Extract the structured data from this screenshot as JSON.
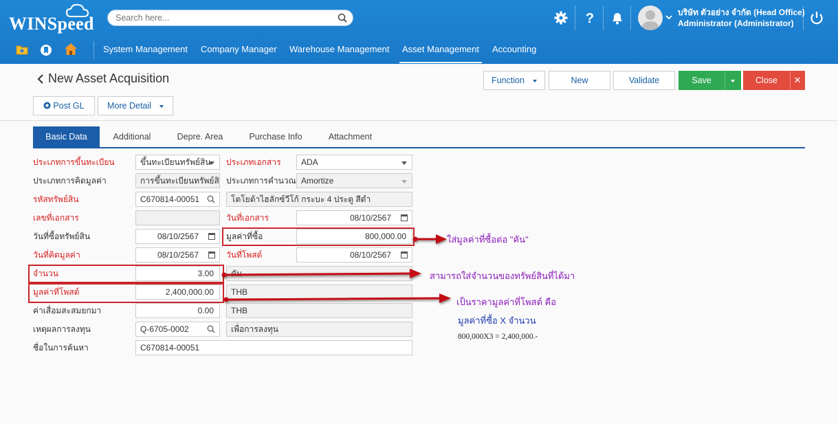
{
  "app": {
    "logo": "WINSpeed",
    "search_placeholder": "Search here...",
    "user_company": "บริษัท ตัวอย่าง จำกัด (Head Office)",
    "user_name": "Administrator (Administrator)"
  },
  "nav": [
    "System Management",
    "Company Manager",
    "Warehouse Management",
    "Asset Management",
    "Accounting"
  ],
  "page": {
    "title": "New Asset Acquisition",
    "buttons": {
      "function": "Function",
      "new": "New",
      "validate": "Validate",
      "save": "Save",
      "close": "Close",
      "post_gl": "Post GL",
      "more_detail": "More Detail"
    }
  },
  "tabs": [
    "Basic Data",
    "Additional",
    "Depre. Area",
    "Purchase Info",
    "Attachment"
  ],
  "form": {
    "reg_type_label": "ประเภทการขึ้นทะเบียน",
    "reg_type_value": "ขึ้นทะเบียนทรัพย์สิน",
    "doc_type_label": "ประเภทเอกสาร",
    "doc_type_value": "ADA",
    "calc_value_type_label": "ประเภทการคิดมูลค่า",
    "calc_value_type_value": "การขึ้นทะเบียนทรัพย์สิน",
    "calc_type_label": "ประเภทการคำนวณ",
    "calc_type_value": "Amortize",
    "asset_code_label": "รหัสทรัพย์สิน",
    "asset_code_value": "C670814-00051",
    "asset_name_value": "โตโยต้าไฮลักซ์วีโก้ กระบะ 4 ประตู สีดำ",
    "doc_no_label": "เลขที่เอกสาร",
    "doc_no_value": "",
    "doc_date_label": "วันที่เอกสาร",
    "doc_date_value": "08/10/2567",
    "purchase_date_label": "วันที่ซื้อทรัพย์สิน",
    "purchase_date_value": "08/10/2567",
    "purchase_value_label": "มูลค่าที่ซื้อ",
    "purchase_value_value": "800,000.00",
    "valuation_date_label": "วันที่คิดมูลค่า",
    "valuation_date_value": "08/10/2567",
    "post_date_label": "วันที่โพสต์",
    "post_date_value": "08/10/2567",
    "qty_label": "จำนวน",
    "qty_value": "3.00",
    "unit_value": "คัน",
    "post_value_label": "มูลค่าที่โพสต์",
    "post_value_value": "2,400,000.00",
    "currency1": "THB",
    "accum_depr_label": "ค่าเสื่อมสะสมยกมา",
    "accum_depr_value": "0.00",
    "currency2": "THB",
    "invest_reason_label": "เหตุผลการลงทุน",
    "invest_reason_code": "Q-6705-0002",
    "invest_reason_text": "เพื่อการลงทุน",
    "search_name_label": "ชื่อในการค้นหา",
    "search_name_value": "C670814-00051"
  },
  "annotations": {
    "a1": "ใส่มูลค่าที่ซื้อต่อ \"คัน\"",
    "a2": "สามารถใส่จำนวนของทรัพย์สินที่ได้มา",
    "a3_line1": "เป็นราคามูลค่าที่โพสต์ คือ",
    "a3_line2": "มูลค่าที่ซื้อ X จำนวน",
    "a3_line3": "800,000X3 = 2,400,000.-"
  },
  "colors": {
    "header_blue": "#1f87d6",
    "tab_active": "#1b5da8",
    "save_green": "#2faa53",
    "close_red": "#e24b3e",
    "required_red": "#d62020",
    "annotation_purple": "#8a1bb8"
  }
}
